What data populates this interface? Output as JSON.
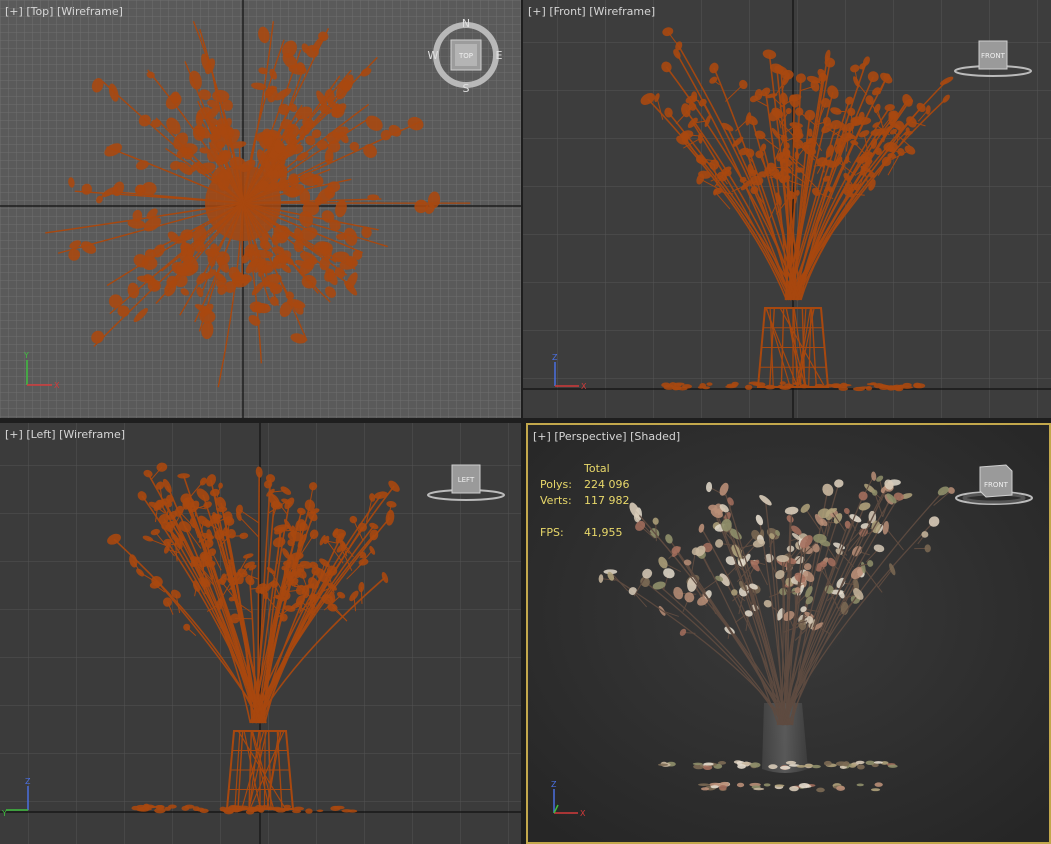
{
  "viewports": {
    "top": {
      "plus": "[+]",
      "name": "[Top]",
      "mode": "[Wireframe]",
      "cube_label": "TOP",
      "compass": {
        "n": "N",
        "s": "S",
        "e": "E",
        "w": "W"
      }
    },
    "front": {
      "plus": "[+]",
      "name": "[Front]",
      "mode": "[Wireframe]",
      "cube_label": "FRONT"
    },
    "left": {
      "plus": "[+]",
      "name": "[Left]",
      "mode": "[Wireframe]",
      "cube_label": "LEFT"
    },
    "perspective": {
      "plus": "[+]",
      "name": "[Perspective]",
      "mode": "[Shaded]",
      "cube_label": "FRONT",
      "stats": {
        "header": "Total",
        "polys_label": "Polys:",
        "polys_value": "224 096",
        "verts_label": "Verts:",
        "verts_value": "117 982",
        "fps_label": "FPS:",
        "fps_value": "41,955"
      }
    }
  },
  "axis_labels": {
    "x": "X",
    "y": "Y",
    "z": "Z"
  },
  "colors": {
    "wire": "#a8480f",
    "active_border": "#c3a84c",
    "stats_text": "#e8d86a",
    "axis_x": "#d23a3a",
    "axis_y": "#3fbf3f",
    "axis_z": "#4a6fe0"
  }
}
